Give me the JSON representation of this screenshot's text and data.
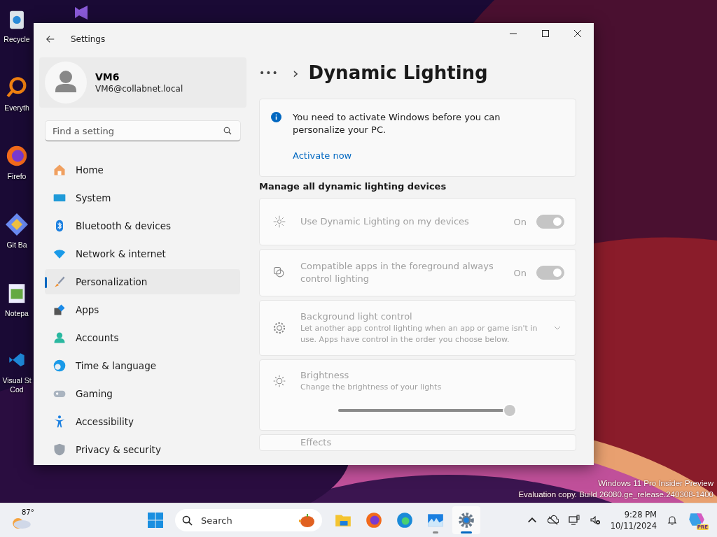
{
  "desktop_icons": [
    {
      "label": "Recycle"
    },
    {
      "label": "Everyth"
    },
    {
      "label": "Firefo"
    },
    {
      "label": "Git Ba"
    },
    {
      "label": "Notepa"
    },
    {
      "label": "Visual St\nCod"
    }
  ],
  "window": {
    "title": "Settings"
  },
  "profile": {
    "name": "VM6",
    "email": "VM6@collabnet.local"
  },
  "search": {
    "placeholder": "Find a setting"
  },
  "sidebar": {
    "items": [
      {
        "label": "Home",
        "selected": false
      },
      {
        "label": "System",
        "selected": false
      },
      {
        "label": "Bluetooth & devices",
        "selected": false
      },
      {
        "label": "Network & internet",
        "selected": false
      },
      {
        "label": "Personalization",
        "selected": true
      },
      {
        "label": "Apps",
        "selected": false
      },
      {
        "label": "Accounts",
        "selected": false
      },
      {
        "label": "Time & language",
        "selected": false
      },
      {
        "label": "Gaming",
        "selected": false
      },
      {
        "label": "Accessibility",
        "selected": false
      },
      {
        "label": "Privacy & security",
        "selected": false
      }
    ]
  },
  "breadcrumb": {
    "more": "•••",
    "separator": "›",
    "title": "Dynamic Lighting"
  },
  "notice": {
    "text": "You need to activate Windows before you can personalize your PC.",
    "link": "Activate now"
  },
  "section_title": "Manage all dynamic lighting devices",
  "settings": [
    {
      "kind": "toggle",
      "title": "Use Dynamic Lighting on my devices",
      "state_text": "On",
      "on": true,
      "disabled": true
    },
    {
      "kind": "toggle",
      "title": "Compatible apps in the foreground always control lighting",
      "state_text": "On",
      "on": true,
      "disabled": true
    },
    {
      "kind": "expander",
      "title": "Background light control",
      "description": "Let another app control lighting when an app or game isn't in use. Apps have control in the order you choose below.",
      "expanded": false,
      "disabled": true
    },
    {
      "kind": "slider",
      "title": "Brightness",
      "description": "Change the brightness of your lights",
      "level": 1,
      "disabled": true
    },
    {
      "kind": "plain",
      "title": "Effects",
      "disabled": true
    }
  ],
  "watermark": {
    "line1": "Windows 11 Pro Insider Preview",
    "line2": "Evaluation copy. Build 26080.ge_release.240308-1400"
  },
  "taskbar": {
    "weather": "87°",
    "search_placeholder": "Search",
    "apps": [
      {
        "selected": false,
        "running": false
      },
      {
        "selected": false,
        "running": false
      },
      {
        "selected": false,
        "running": false
      },
      {
        "selected": false,
        "running": true
      },
      {
        "selected": true,
        "running": true
      }
    ],
    "clock": {
      "time": "9:28 PM",
      "date": "10/11/2024"
    },
    "copilot_badge": "PRE"
  }
}
